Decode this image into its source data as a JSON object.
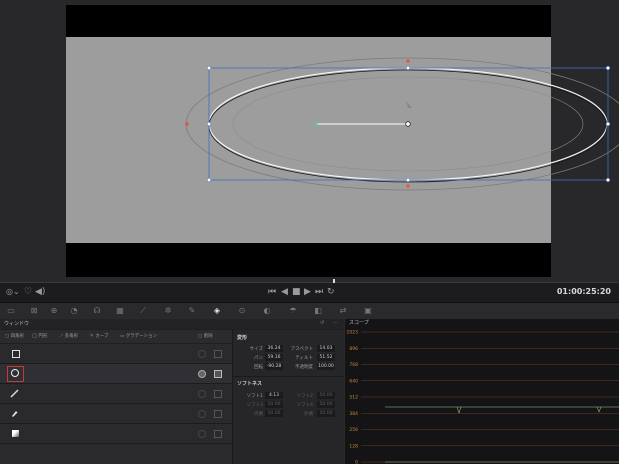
{
  "viewer": {
    "frame_color": "#9d9d9d",
    "mask_color": "#000000",
    "handle_color": "#3b6fbf",
    "pivot_color": "#e0583d"
  },
  "transport": {
    "timecode": "01:00:25:20",
    "buttons": [
      "skip-start-icon",
      "step-back-icon",
      "stop-icon",
      "play-icon",
      "skip-end-icon",
      "loop-icon"
    ]
  },
  "window_panel": {
    "title": "ウィンドウ",
    "shape_tabs": [
      "四角形",
      "円形",
      "多角形",
      "カーブ",
      "グラデーション"
    ],
    "delete_label": "削除",
    "shapes": [
      {
        "icon": "square-icon",
        "selected": false
      },
      {
        "icon": "circle-icon",
        "selected": true
      },
      {
        "icon": "pen-line-icon",
        "selected": false
      },
      {
        "icon": "brush-icon",
        "selected": false
      },
      {
        "icon": "gradient-icon",
        "selected": false
      }
    ]
  },
  "transform": {
    "section_title": "変形",
    "size_label": "サイズ",
    "size_value": "36.24",
    "aspect_label": "アスペクト",
    "aspect_value": "14.03",
    "pan_label": "パン",
    "pan_value": "59.16",
    "tilt_label": "ティルト",
    "tilt_value": "51.52",
    "rotate_label": "回転",
    "rotate_value": "-90.28",
    "opacity_label": "不透明度",
    "opacity_value": "100.00",
    "soft_title": "ソフトネス",
    "soft1_label": "ソフト1",
    "soft1_value": "4.13",
    "soft2_label": "ソフト2",
    "soft2_value": "50.00",
    "soft3_label": "ソフト3",
    "soft3_value": "50.00",
    "soft4_label": "ソフト4",
    "soft4_value": "50.00",
    "inside_label": "内側",
    "inside_value": "50.00",
    "outside_label": "外側",
    "outside_value": "50.00"
  },
  "scope": {
    "title": "スコープ",
    "ticks": [
      "1023",
      "896",
      "768",
      "640",
      "512",
      "384",
      "256",
      "128",
      "0"
    ]
  }
}
